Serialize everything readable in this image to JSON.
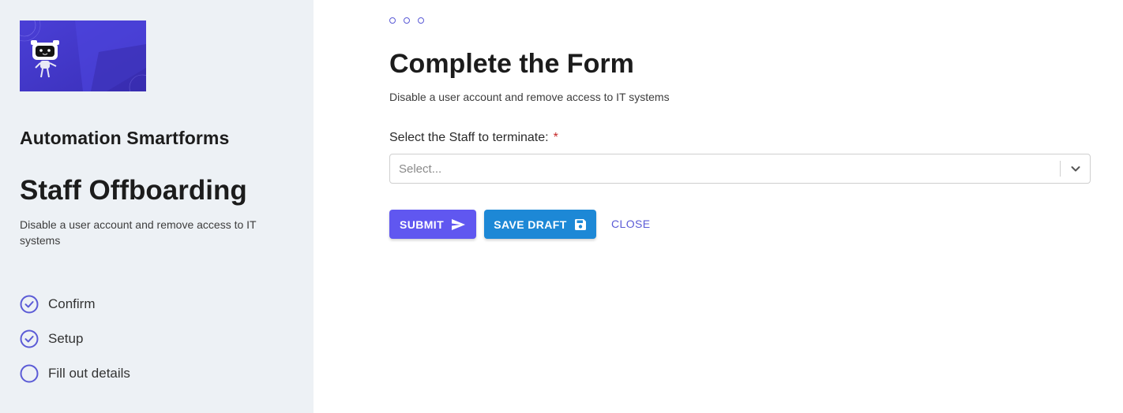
{
  "sidebar": {
    "app_name": "Automation Smartforms",
    "form_title": "Staff Offboarding",
    "form_description": "Disable a user account and remove access to IT systems",
    "steps": [
      {
        "label": "Confirm",
        "state": "completed",
        "icon": "check-circle-icon"
      },
      {
        "label": "Setup",
        "state": "completed",
        "icon": "check-circle-icon"
      },
      {
        "label": "Fill out details",
        "state": "current",
        "icon": "empty-circle-icon"
      }
    ]
  },
  "main": {
    "title": "Complete the Form",
    "description": "Disable a user account and remove access to IT systems",
    "field": {
      "label": "Select the Staff to terminate:",
      "required_mark": "*",
      "placeholder": "Select..."
    },
    "buttons": {
      "submit": "SUBMIT",
      "save_draft": "SAVE DRAFT",
      "close": "CLOSE"
    }
  },
  "colors": {
    "accent": "#5b5bd6",
    "submit": "#6057f0",
    "save_draft": "#1d88d6",
    "sidebar_bg": "#edf1f5",
    "required": "#c62828"
  }
}
